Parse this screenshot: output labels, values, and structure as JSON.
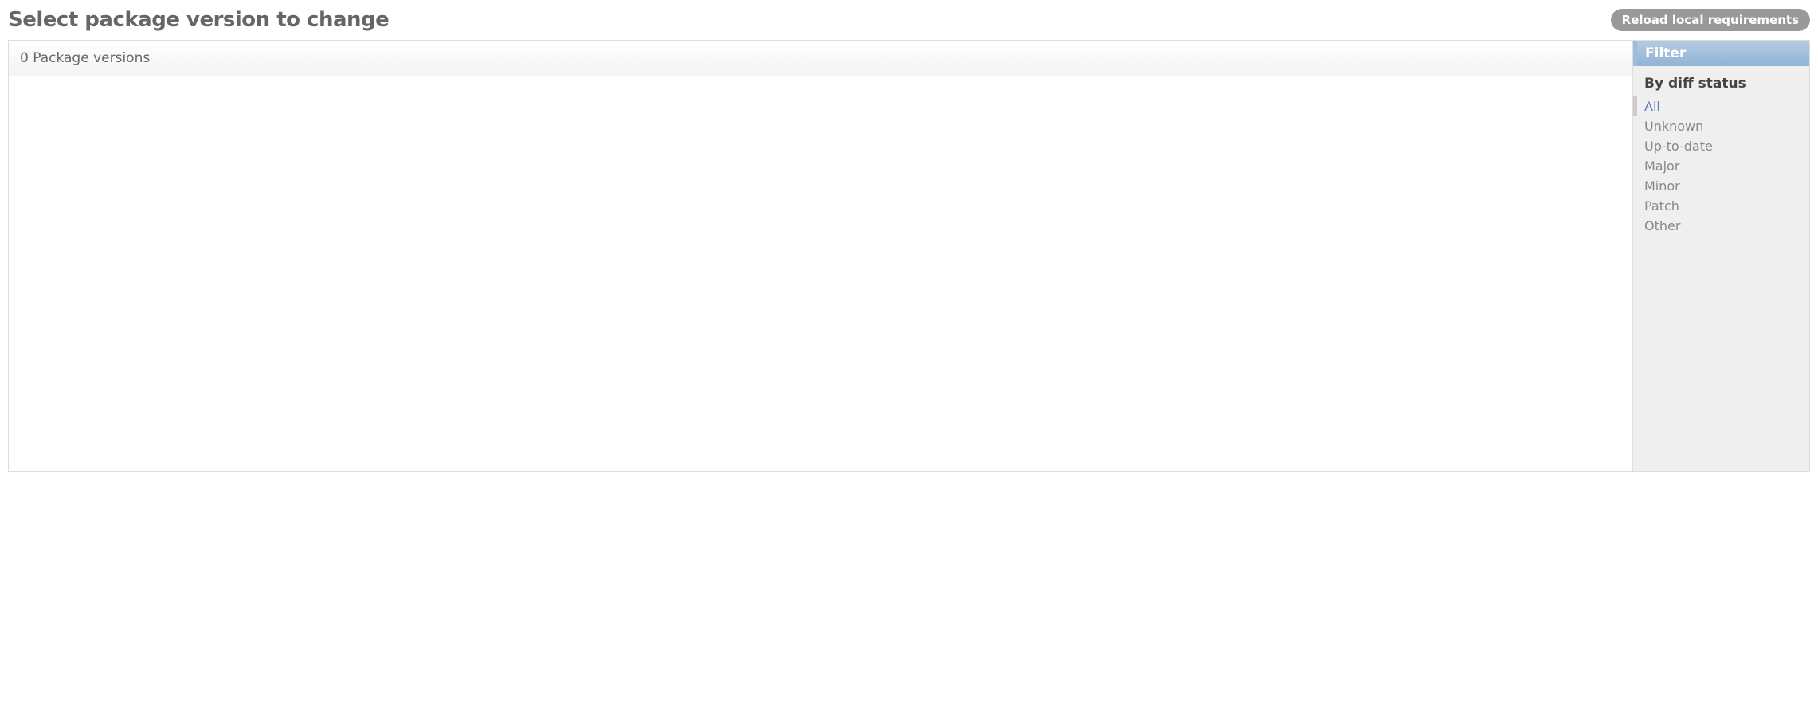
{
  "header": {
    "title": "Select package version to change",
    "action_button": "Reload local requirements"
  },
  "results": {
    "count_text": "0 Package versions"
  },
  "filter": {
    "header": "Filter",
    "groups": [
      {
        "title": "By diff status",
        "items": [
          {
            "label": "All",
            "selected": true
          },
          {
            "label": "Unknown",
            "selected": false
          },
          {
            "label": "Up-to-date",
            "selected": false
          },
          {
            "label": "Major",
            "selected": false
          },
          {
            "label": "Minor",
            "selected": false
          },
          {
            "label": "Patch",
            "selected": false
          },
          {
            "label": "Other",
            "selected": false
          }
        ]
      }
    ]
  }
}
